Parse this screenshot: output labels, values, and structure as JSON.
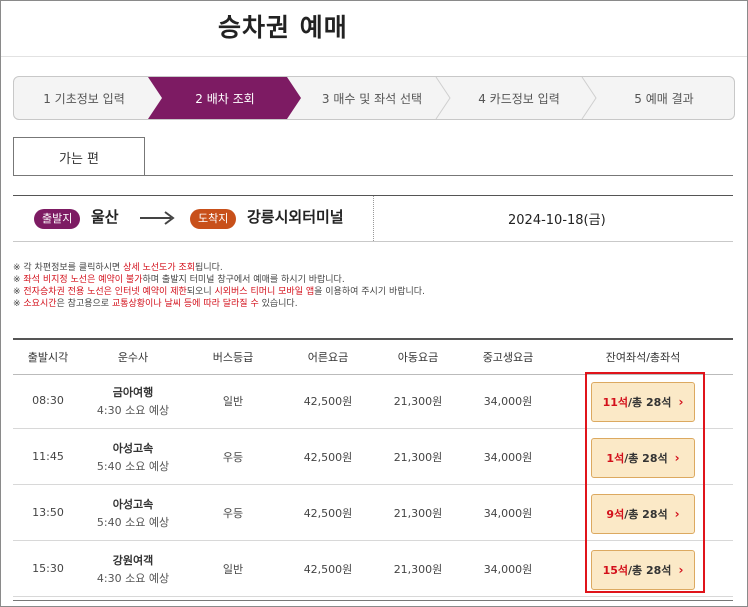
{
  "page_title": "승차권 예매",
  "steps": [
    {
      "label": "1 기초정보 입력",
      "active": false
    },
    {
      "label": "2 배차 조회",
      "active": true
    },
    {
      "label": "3 매수 및 좌석 선택",
      "active": false
    },
    {
      "label": "4 카드정보 입력",
      "active": false
    },
    {
      "label": "5 예매 결과",
      "active": false
    }
  ],
  "tab_label": "가는 편",
  "route": {
    "departure_badge": "출발지",
    "departure": "울산",
    "arrival_badge": "도착지",
    "arrival": "강릉시외터미널",
    "date": "2024-10-18(금)"
  },
  "notes": [
    [
      {
        "t": "※ 각 차편정보를 클릭하시면 "
      },
      {
        "t": "상세 노선도가 조회",
        "red": true
      },
      {
        "t": "됩니다."
      }
    ],
    [
      {
        "t": "※ "
      },
      {
        "t": "좌석 비지정 노선은 예약이 불가",
        "red": true
      },
      {
        "t": "하며 출발지 터미널 창구에서 예매를 하시기 바랍니다."
      }
    ],
    [
      {
        "t": "※ "
      },
      {
        "t": "전자승차권 전용 노선은 인터넷 예약이 제한",
        "red": true
      },
      {
        "t": "되오니 "
      },
      {
        "t": "시외버스 티머니 모바일 앱",
        "red": true
      },
      {
        "t": "을 이용하여 주시기 바랍니다."
      }
    ],
    [
      {
        "t": "※ "
      },
      {
        "t": "소요시간",
        "red": true
      },
      {
        "t": "은 참고용으로 "
      },
      {
        "t": "교통상황이나 날씨 등에 따라 달라질 수",
        "red": true
      },
      {
        "t": " 있습니다."
      }
    ]
  ],
  "table": {
    "headers": [
      "출발시각",
      "운수사",
      "버스등급",
      "어른요금",
      "아동요금",
      "중고생요금",
      "잔여좌석/총좌석"
    ],
    "rows": [
      {
        "time": "08:30",
        "carrier": "금아여행",
        "duration": "4:30 소요 예상",
        "grade": "일반",
        "adult": "42,500원",
        "child": "21,300원",
        "youth": "34,000원",
        "remaining": "11석",
        "total": "/총 28석"
      },
      {
        "time": "11:45",
        "carrier": "아성고속",
        "duration": "5:40 소요 예상",
        "grade": "우등",
        "adult": "42,500원",
        "child": "21,300원",
        "youth": "34,000원",
        "remaining": "1석",
        "total": "/총 28석"
      },
      {
        "time": "13:50",
        "carrier": "아성고속",
        "duration": "5:40 소요 예상",
        "grade": "우등",
        "adult": "42,500원",
        "child": "21,300원",
        "youth": "34,000원",
        "remaining": "9석",
        "total": "/총 28석"
      },
      {
        "time": "15:30",
        "carrier": "강원여객",
        "duration": "4:30 소요 예상",
        "grade": "일반",
        "adult": "42,500원",
        "child": "21,300원",
        "youth": "34,000원",
        "remaining": "15석",
        "total": "/총 28석"
      }
    ]
  },
  "colors": {
    "active_step": "#7d1b63",
    "departure_badge": "#7d1b63",
    "arrival_badge": "#c8501a",
    "highlight": "#e0141b",
    "seat_button": "#fbe9c7"
  },
  "icons": {
    "route_arrow": "right-arrow-icon",
    "seat_chevron": "chevron-right-icon"
  }
}
